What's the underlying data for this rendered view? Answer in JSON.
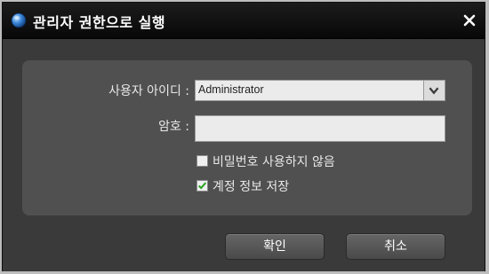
{
  "dialog": {
    "title": "관리자 권한으로 실행"
  },
  "form": {
    "user_id_label": "사용자 아이디 :",
    "user_id_value": "Administrator",
    "password_label": "암호 :",
    "password_value": "",
    "no_password_label": "비밀번호 사용하지 않음",
    "no_password_checked": false,
    "save_account_label": "계정 정보 저장",
    "save_account_checked": true
  },
  "buttons": {
    "ok_label": "확인",
    "cancel_label": "취소"
  },
  "icons": {
    "title_icon": "globe-icon",
    "close_icon": "close-icon",
    "dropdown_icon": "chevron-down-icon",
    "check_icon": "check-icon"
  },
  "colors": {
    "titlebar": "#0c0c0c",
    "background": "#3a3a3a",
    "panel": "#505050",
    "check_green": "#2aa11e"
  }
}
